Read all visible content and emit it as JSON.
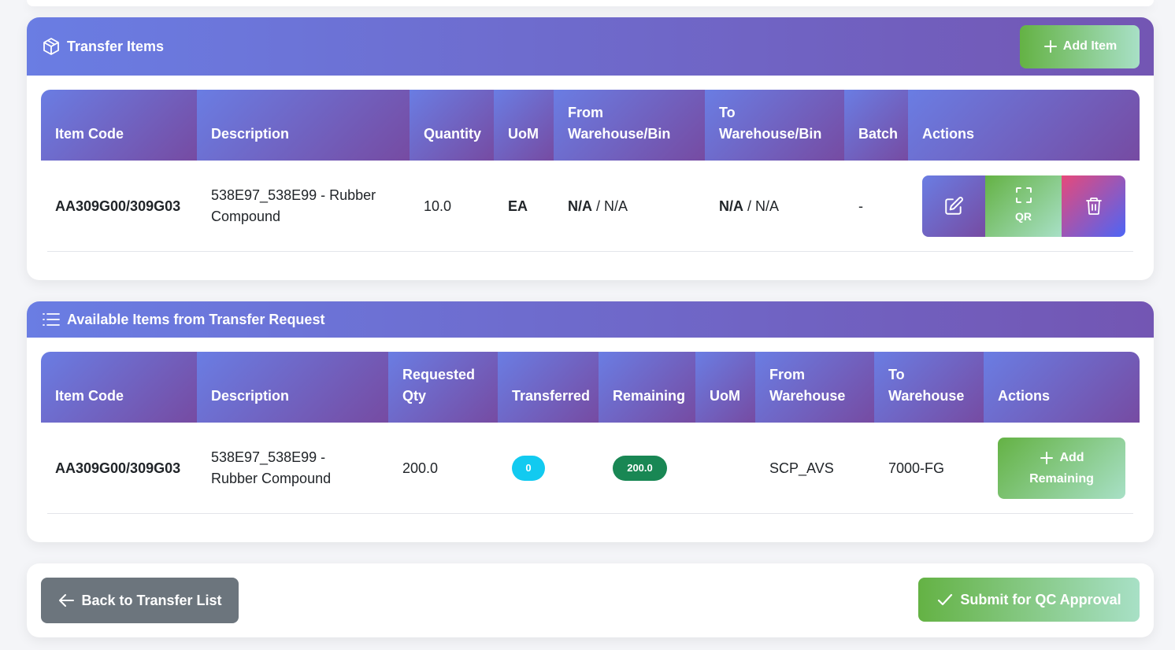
{
  "transfer_items": {
    "title": "Transfer Items",
    "add_button": "Add Item",
    "columns": [
      "Item Code",
      "Description",
      "Quantity",
      "UoM",
      "From Warehouse/Bin",
      "To Warehouse/Bin",
      "Batch",
      "Actions"
    ],
    "rows": [
      {
        "item_code": "AA309G00/309G03",
        "description": "538E97_538E99 - Rubber Compound",
        "quantity": "10.0",
        "uom": "EA",
        "from_wh": "N/A",
        "from_bin": " / N/A",
        "to_wh": "N/A",
        "to_bin": " / N/A",
        "batch": "-",
        "qr_label": "QR"
      }
    ]
  },
  "available_items": {
    "title": "Available Items from Transfer Request",
    "columns": [
      "Item Code",
      "Description",
      "Requested Qty",
      "Transferred",
      "Remaining",
      "UoM",
      "From Warehouse",
      "To Warehouse",
      "Actions"
    ],
    "rows": [
      {
        "item_code": "AA309G00/309G03",
        "description": "538E97_538E99 - Rubber Compound",
        "requested_qty": "200.0",
        "transferred": "0",
        "remaining": "200.0",
        "uom": "",
        "from_warehouse": "SCP_AVS",
        "to_warehouse": "7000-FG",
        "action_line1": "Add",
        "action_line2": "Remaining"
      }
    ]
  },
  "footer": {
    "back_button": "Back to Transfer List",
    "submit_button": "Submit for QC Approval"
  },
  "colors": {
    "header_gradient_start": "#6a7de3",
    "header_gradient_end": "#764ba2",
    "success_gradient_start": "#64b244",
    "success_gradient_end": "#a8e0c6",
    "badge_info": "#12caf0",
    "badge_success": "#198754",
    "secondary": "#6c757d"
  },
  "icons": [
    "box-icon",
    "plus-icon",
    "edit-icon",
    "qr-scan-icon",
    "trash-icon",
    "list-icon",
    "arrow-left-icon",
    "check-icon"
  ]
}
